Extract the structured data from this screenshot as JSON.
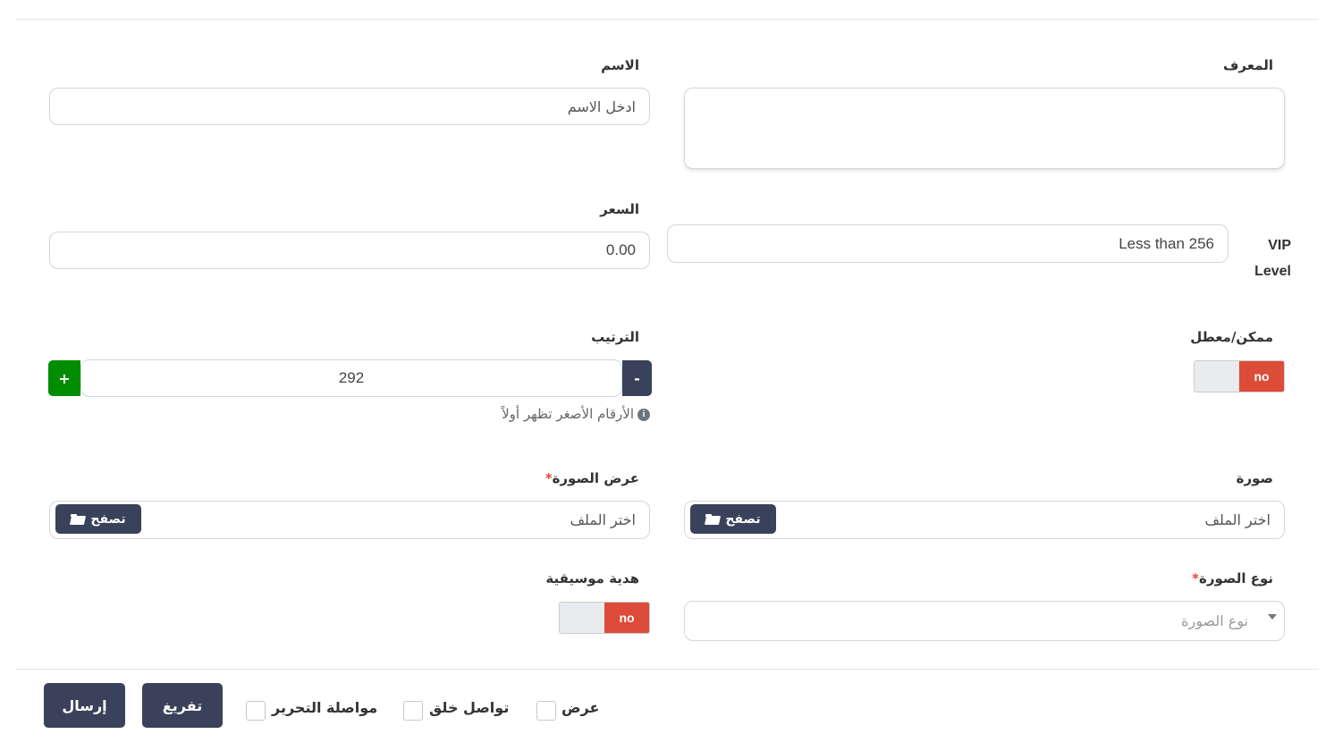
{
  "form": {
    "id_label": "المعرف",
    "name_label": "الاسم",
    "name_placeholder": "ادخل الاسم",
    "vip_label": "VIP Level",
    "vip_value": "Less than 256",
    "price_label": "السعر",
    "price_value": "0.00",
    "enabled_label": "ممكن/معطل",
    "enabled_state": "no",
    "order_label": "الترتيب",
    "order_value": "292",
    "order_minus": "-",
    "order_plus": "+",
    "order_help": "الأرقام الأصغر تظهر أولاً",
    "image_label": "صورة",
    "image_placeholder": "اختر الملف",
    "image_browse": "تصفح",
    "display_image_label": "عرض الصورة",
    "display_image_placeholder": "اختر الملف",
    "display_image_browse": "تصفح",
    "required_mark": "*",
    "image_type_label": "نوع الصورة",
    "image_type_placeholder": "نوع الصورة",
    "music_gift_label": "هدية موسيقية",
    "music_gift_state": "no"
  },
  "footer": {
    "view_label": "عرض",
    "continue_create_label": "تواصل خلق",
    "continue_edit_label": "مواصلة التحرير",
    "reset_label": "تفريغ",
    "submit_label": "إرسال"
  },
  "colors": {
    "dark_button": "#39425a",
    "switch_no": "#dd4b39",
    "plus_button": "#008d00"
  }
}
